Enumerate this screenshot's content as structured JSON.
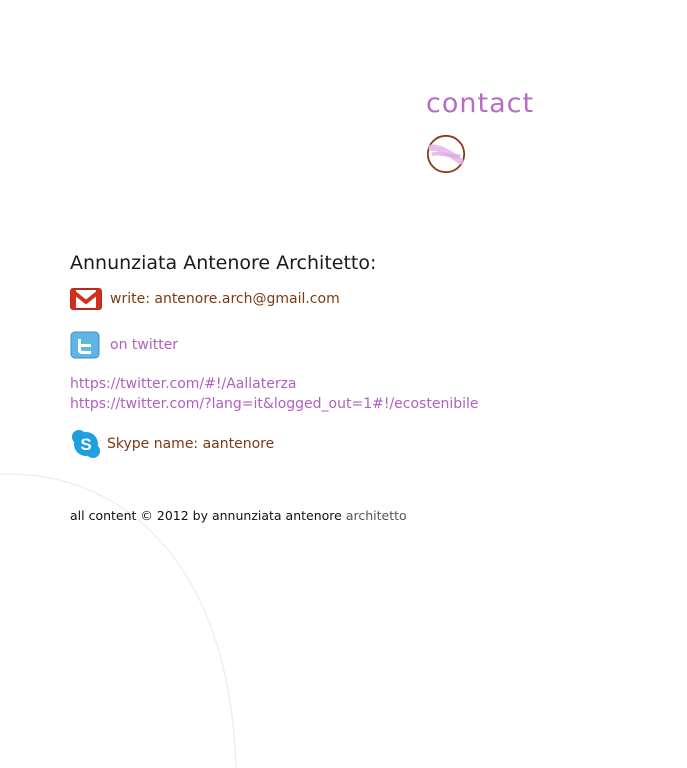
{
  "page": {
    "title": "contact",
    "heading": "Annunziata Antenore Architetto:",
    "gmail": {
      "label": "write: antenore.arch@gmail.com",
      "icon": "gmail-icon"
    },
    "twitter": {
      "label": "on twitter",
      "icon": "twitter-icon"
    },
    "links": [
      "https://twitter.com/#!/Aallaterza",
      "https://twitter.com/?lang=it&logged_out=1#!/ecostenibile"
    ],
    "skype": {
      "label": "Skype name: aantenore",
      "icon": "skype-icon"
    },
    "footer": {
      "main": "all content © 2012 by annunziata antenore ",
      "accent": "architetto"
    }
  },
  "colors": {
    "title": "#b86cc8",
    "link": "#b060c0",
    "brown_text": "#7a3a12",
    "circle_border": "#8b3a1a"
  }
}
